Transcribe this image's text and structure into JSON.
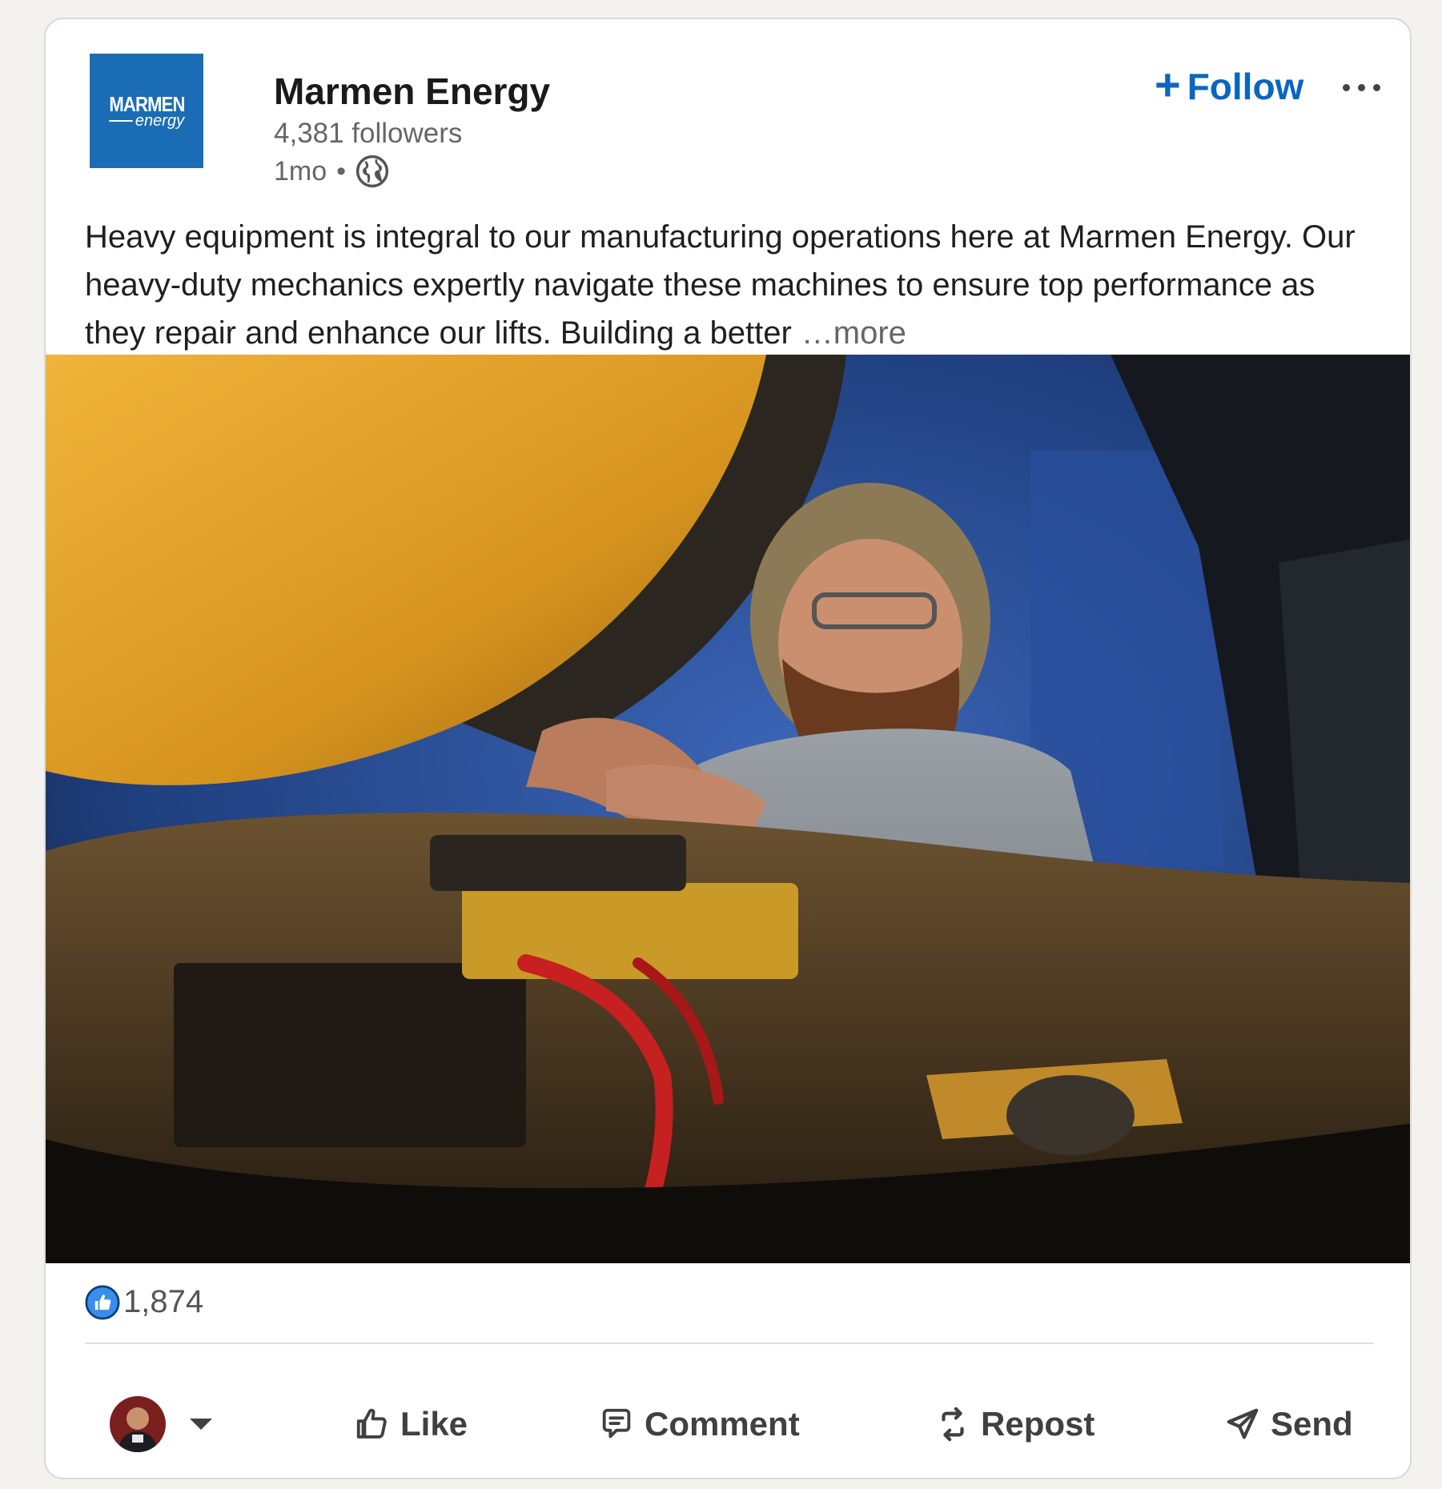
{
  "company": {
    "name": "Marmen Energy",
    "followers": "4,381 followers",
    "age": "1mo",
    "separator": "•",
    "logo_line1": "MARMEN",
    "logo_line2": "energy"
  },
  "follow_label": "Follow",
  "follow_plus": "+",
  "post": {
    "text": "Heavy equipment is integral to our manufacturing operations here at Marmen Energy. Our heavy-duty mechanics expertly navigate these machines to ensure top performance as they repair and enhance our lifts. Building a better",
    "see_more": "…more"
  },
  "image_icon": "mechanic-working-on-forklift-engine-photo",
  "reactions": {
    "icon": "like-reaction-icon",
    "count": "1,874"
  },
  "actions": {
    "like": "Like",
    "comment": "Comment",
    "repost": "Repost",
    "send": "Send"
  },
  "colors": {
    "accent": "#0a66c2",
    "logo_bg": "#1a6db4",
    "machine_yellow": "#e2a227",
    "background_blue": "#2c58a6"
  }
}
